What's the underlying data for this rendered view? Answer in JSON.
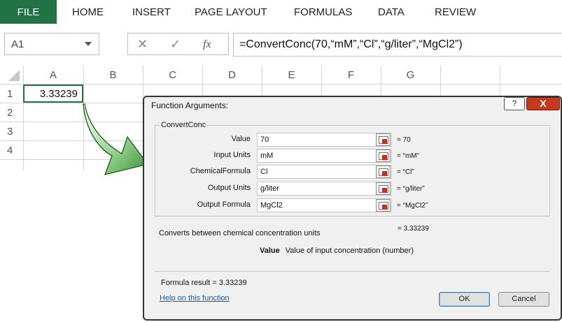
{
  "ribbon": {
    "tabs": [
      "FILE",
      "HOME",
      "INSERT",
      "PAGE LAYOUT",
      "FORMULAS",
      "DATA",
      "REVIEW"
    ]
  },
  "formula_bar": {
    "name_box": "A1",
    "cancel_icon": "✕",
    "enter_icon": "✓",
    "fx_icon": "fx",
    "formula": "=ConvertConc(70,“mM”,“Cl”,“g/liter”,“MgCl2”)"
  },
  "sheet": {
    "columns": [
      "A",
      "B",
      "C",
      "D",
      "E",
      "F",
      "G"
    ],
    "rows": [
      "1",
      "2",
      "3",
      "4"
    ],
    "cell_a1": "3.33239"
  },
  "dialog": {
    "title": "Function Arguments:",
    "help_button": "?",
    "close_button": "X",
    "function_name": "ConvertConc",
    "arguments": [
      {
        "label": "Value",
        "value": "70",
        "result": "= 70"
      },
      {
        "label": "Input Units",
        "value": "mM",
        "result": "= “mM”"
      },
      {
        "label": "ChemicalFormula",
        "value": "Cl",
        "result": "= “Cl”"
      },
      {
        "label": "Output Units",
        "value": "g/liter",
        "result": "= “g/liter”"
      },
      {
        "label": "Output Formula",
        "value": "MgCl2",
        "result": "= “MgCl2”"
      }
    ],
    "description": "Converts between chemical concentration units",
    "function_result": "= 3.33239",
    "arg_help_name": "Value",
    "arg_help_text": "Value of input concentration (number)",
    "formula_result": "Formula result = 3.33239",
    "help_link": "Help on this function",
    "ok_label": "OK",
    "cancel_label": "Cancel"
  },
  "colors": {
    "file_tab": "#217346",
    "selection": "#217346",
    "close_button": "#c5391f",
    "arrow_fill": "#5fae5a"
  }
}
